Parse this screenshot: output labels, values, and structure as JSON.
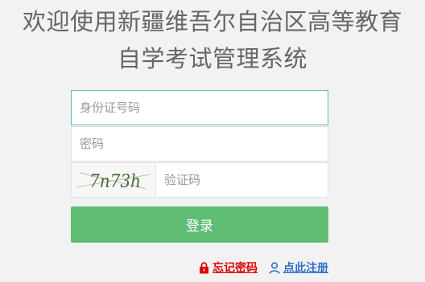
{
  "header": {
    "title_line1": "欢迎使用新疆维吾尔自治区高等教育",
    "title_line2": "自学考试管理系统"
  },
  "form": {
    "id_placeholder": "身份证号码",
    "password_placeholder": "密码",
    "captcha_placeholder": "验证码",
    "captcha_image_text": "7n73h",
    "login_label": "登录"
  },
  "links": {
    "forgot_label": "忘记密码",
    "register_label": "点此注册"
  },
  "colors": {
    "login_button": "#5fbd74",
    "forgot_link": "#e00000",
    "register_link": "#2f6fc6",
    "active_border": "#5bb8c4"
  },
  "icons": {
    "forgot": "lock-icon",
    "register": "user-icon"
  }
}
